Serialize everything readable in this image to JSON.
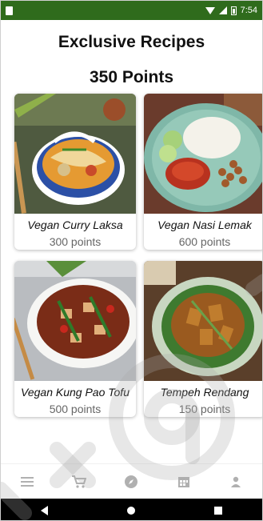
{
  "status": {
    "time": "7:54"
  },
  "header": {
    "title": "Exclusive Recipes",
    "points": "350 Points"
  },
  "recipes": [
    {
      "name": "Vegan Curry Laksa",
      "points": "300 points"
    },
    {
      "name": "Vegan Nasi Lemak",
      "points": "600 points"
    },
    {
      "name": "Vegan Kung Pao Tofu",
      "points": "500 points"
    },
    {
      "name": "Tempeh Rendang",
      "points": "150 points"
    }
  ],
  "bottom_nav": {
    "icons": [
      "menu-icon",
      "cart-icon",
      "explore-icon",
      "calendar-icon",
      "profile-icon"
    ]
  },
  "colors": {
    "status_bar": "#2f6b1c",
    "nav_icon": "#b0b0b0"
  }
}
